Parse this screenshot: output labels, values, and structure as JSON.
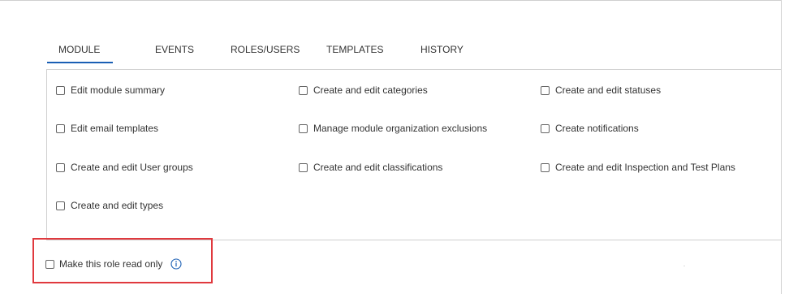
{
  "tabs": [
    {
      "label": "MODULE",
      "active": true
    },
    {
      "label": "EVENTS",
      "active": false
    },
    {
      "label": "ROLES/USERS",
      "active": false
    },
    {
      "label": "TEMPLATES",
      "active": false
    },
    {
      "label": "HISTORY",
      "active": false
    }
  ],
  "permissions": {
    "col1": [
      {
        "label": "Edit module summary",
        "checked": false
      },
      {
        "label": "Edit email templates",
        "checked": false
      },
      {
        "label": "Create and edit User groups",
        "checked": false
      },
      {
        "label": "Create and edit types",
        "checked": false
      }
    ],
    "col2": [
      {
        "label": "Create and edit categories",
        "checked": false
      },
      {
        "label": "Manage module organization exclusions",
        "checked": false
      },
      {
        "label": "Create and edit classifications",
        "checked": false
      }
    ],
    "col3": [
      {
        "label": "Create and edit statuses",
        "checked": false
      },
      {
        "label": "Create notifications",
        "checked": false
      },
      {
        "label": "Create and edit Inspection and Test Plans",
        "checked": false
      }
    ]
  },
  "read_only": {
    "label": "Make this role read only",
    "checked": false,
    "icon": "info-icon"
  },
  "colors": {
    "active_tab_underline": "#1a5fb4",
    "highlight_border": "#e0393e",
    "info_icon": "#1a5fb4"
  }
}
